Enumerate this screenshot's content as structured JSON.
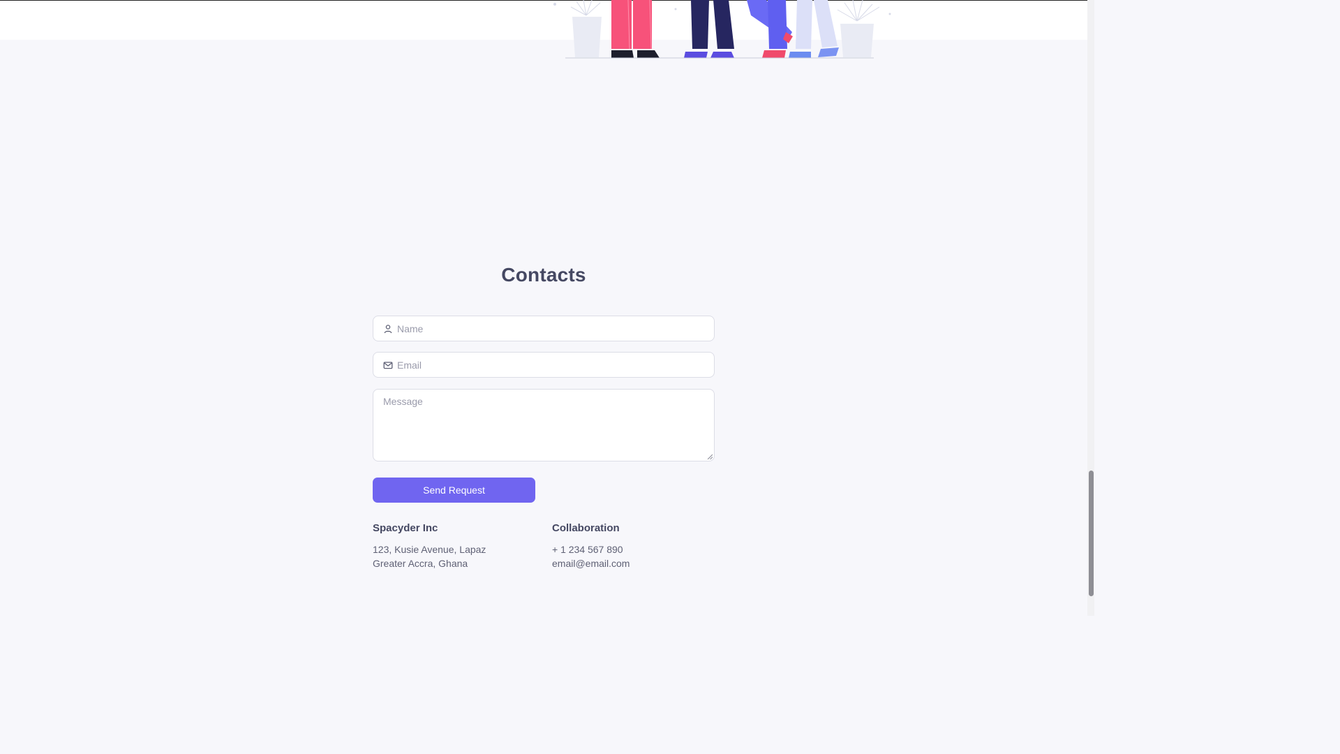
{
  "contacts": {
    "title": "Contacts",
    "name_placeholder": "Name",
    "email_placeholder": "Email",
    "message_placeholder": "Message",
    "send_label": "Send Request"
  },
  "company": {
    "name": "Spacyder Inc",
    "address_line1": "123, Kusie Avenue, Lapaz",
    "address_line2": "Greater Accra, Ghana"
  },
  "collaboration": {
    "title": "Collaboration",
    "phone": "+ 1 234 567 890",
    "email": "email@email.com"
  },
  "colors": {
    "accent": "#7065f0",
    "page_bg": "#f7f7fb",
    "heading": "#454862"
  },
  "icons": {
    "name_field": "user-icon",
    "email_field": "mail-icon"
  }
}
